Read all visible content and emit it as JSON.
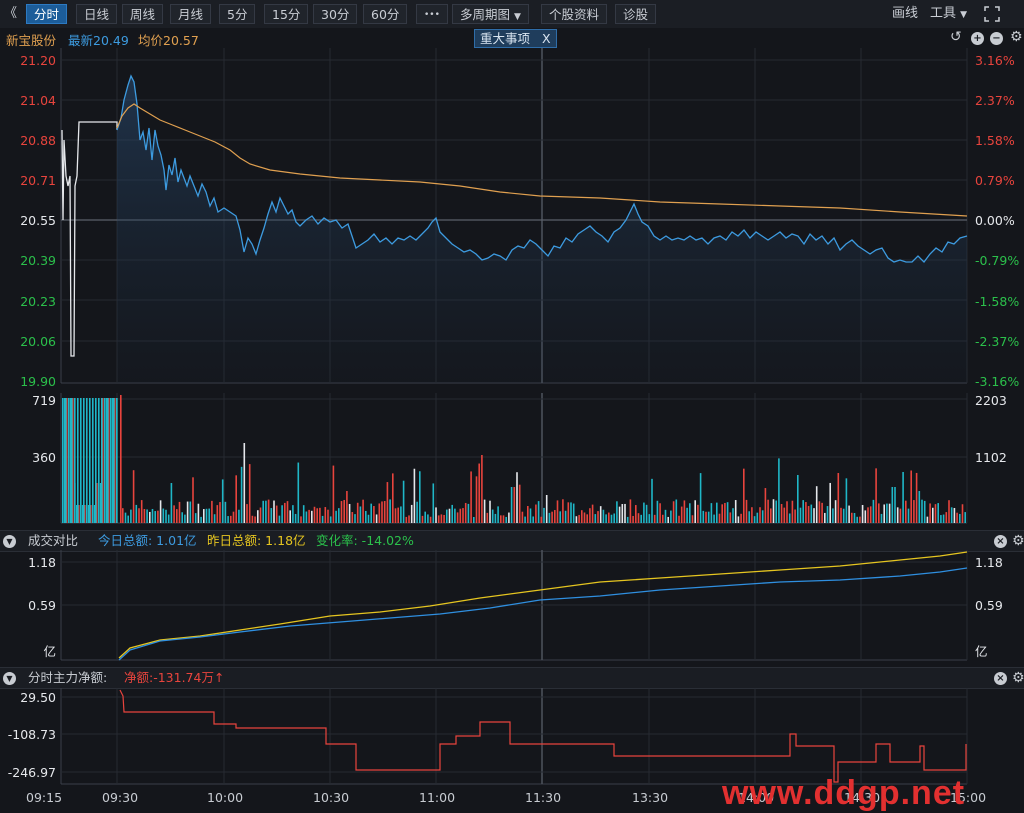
{
  "toolbar": {
    "back_glyph": "《",
    "tabs": [
      {
        "label": "分时",
        "active": true
      },
      {
        "label": "日线"
      },
      {
        "label": "周线"
      },
      {
        "label": "月线"
      },
      {
        "label": "5分"
      },
      {
        "label": "15分"
      },
      {
        "label": "30分"
      },
      {
        "label": "60分"
      }
    ],
    "more_glyph": "•••",
    "multi_period": "多周期图",
    "stock_info": "个股资料",
    "diagnose": "诊股",
    "draw": "画线",
    "tools": "工具"
  },
  "quote": {
    "name": "新宝股份",
    "latest_label": "最新20.49",
    "avg_label": "均价20.57",
    "event_badge": "重大事项",
    "event_close": "X"
  },
  "price_axis": {
    "left": [
      "21.20",
      "21.04",
      "20.88",
      "20.71",
      "20.55",
      "20.39",
      "20.23",
      "20.06",
      "19.90"
    ],
    "right": [
      "3.16%",
      "2.37%",
      "1.58%",
      "0.79%",
      "0.00%",
      "-0.79%",
      "-1.58%",
      "-2.37%",
      "-3.16%"
    ]
  },
  "volume_axis": {
    "left": [
      "719",
      "360"
    ],
    "right": [
      "2203",
      "1102"
    ]
  },
  "turnover_panel": {
    "title": "成交对比",
    "today": "今日总额: 1.01亿",
    "yesterday": "昨日总额: 1.18亿",
    "change": "变化率: -14.02%",
    "axis_left": [
      "1.18",
      "0.59",
      "亿"
    ],
    "axis_right": [
      "1.18",
      "0.59",
      "亿"
    ]
  },
  "flow_panel": {
    "title": "分时主力净额:",
    "net": "净额:-131.74万",
    "net_arrow": "↑",
    "axis_left": [
      "29.50",
      "-108.73",
      "-246.97"
    ]
  },
  "time_axis": [
    "09:15",
    "09:30",
    "10:00",
    "10:30",
    "11:00",
    "11:30",
    "13:30",
    "14:00",
    "14:30",
    "15:00"
  ],
  "watermark": "www.ddgp.net",
  "colors": {
    "price_line": "#3d9be0",
    "avg_line": "#e0a050",
    "today_line": "#2f8fe0",
    "yesterday_line": "#e5c520",
    "flow_line": "#e8443d",
    "up": "#e8443d",
    "down": "#2bc04b",
    "active_tab": "#1c5d9a"
  }
}
